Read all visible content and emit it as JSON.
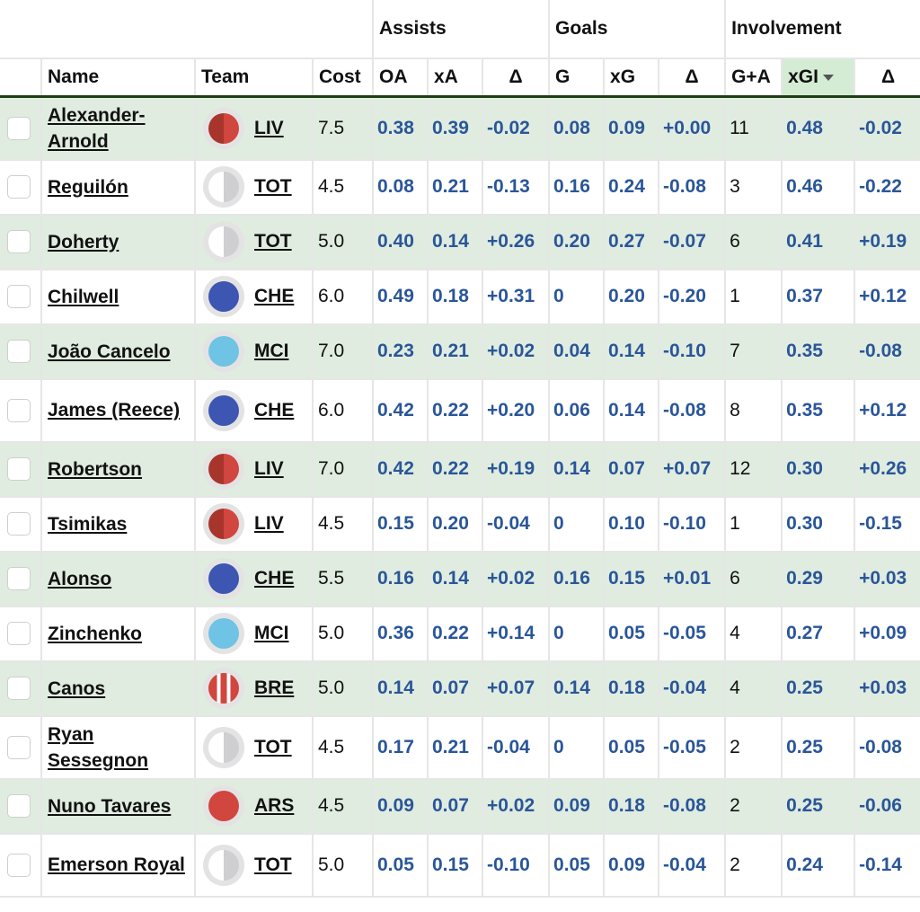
{
  "groups": {
    "assists": "Assists",
    "goals": "Goals",
    "involvement": "Involvement"
  },
  "columns": {
    "name": "Name",
    "team": "Team",
    "cost": "Cost",
    "oa": "OA",
    "xa": "xA",
    "da": "Δ",
    "g": "G",
    "xg": "xG",
    "dg": "Δ",
    "ga": "G+A",
    "xgi": "xGI",
    "dgi": "Δ"
  },
  "sort": {
    "column": "xGI",
    "direction": "descending"
  },
  "team_colors": {
    "LIV": {
      "style": "split",
      "left": "#a8352b",
      "right": "#d1463f"
    },
    "TOT": {
      "style": "split",
      "left": "#ffffff",
      "right": "#cfcfd1"
    },
    "CHE": {
      "style": "solid",
      "color": "#3c56b1"
    },
    "MCI": {
      "style": "solid",
      "color": "#6fc3e5"
    },
    "BRE": {
      "style": "stripes",
      "color": "#d1463f",
      "alt": "#ffffff"
    },
    "ARS": {
      "style": "solid",
      "color": "#d1463f"
    }
  },
  "rows": [
    {
      "name": "Alexander-Arnold",
      "team": "LIV",
      "cost": "7.5",
      "oa": "0.38",
      "xa": "0.39",
      "da": "-0.02",
      "g": "0.08",
      "xg": "0.09",
      "dg": "+0.00",
      "ga": "11",
      "xgi": "0.48",
      "dgi": "-0.02"
    },
    {
      "name": "Reguilón",
      "team": "TOT",
      "cost": "4.5",
      "oa": "0.08",
      "xa": "0.21",
      "da": "-0.13",
      "g": "0.16",
      "xg": "0.24",
      "dg": "-0.08",
      "ga": "3",
      "xgi": "0.46",
      "dgi": "-0.22"
    },
    {
      "name": "Doherty",
      "team": "TOT",
      "cost": "5.0",
      "oa": "0.40",
      "xa": "0.14",
      "da": "+0.26",
      "g": "0.20",
      "xg": "0.27",
      "dg": "-0.07",
      "ga": "6",
      "xgi": "0.41",
      "dgi": "+0.19"
    },
    {
      "name": "Chilwell",
      "team": "CHE",
      "cost": "6.0",
      "oa": "0.49",
      "xa": "0.18",
      "da": "+0.31",
      "g": "0",
      "xg": "0.20",
      "dg": "-0.20",
      "ga": "1",
      "xgi": "0.37",
      "dgi": "+0.12"
    },
    {
      "name": "João Cancelo",
      "team": "MCI",
      "cost": "7.0",
      "oa": "0.23",
      "xa": "0.21",
      "da": "+0.02",
      "g": "0.04",
      "xg": "0.14",
      "dg": "-0.10",
      "ga": "7",
      "xgi": "0.35",
      "dgi": "-0.08"
    },
    {
      "name": "James (Reece)",
      "team": "CHE",
      "cost": "6.0",
      "oa": "0.42",
      "xa": "0.22",
      "da": "+0.20",
      "g": "0.06",
      "xg": "0.14",
      "dg": "-0.08",
      "ga": "8",
      "xgi": "0.35",
      "dgi": "+0.12"
    },
    {
      "name": "Robertson",
      "team": "LIV",
      "cost": "7.0",
      "oa": "0.42",
      "xa": "0.22",
      "da": "+0.19",
      "g": "0.14",
      "xg": "0.07",
      "dg": "+0.07",
      "ga": "12",
      "xgi": "0.30",
      "dgi": "+0.26"
    },
    {
      "name": "Tsimikas",
      "team": "LIV",
      "cost": "4.5",
      "oa": "0.15",
      "xa": "0.20",
      "da": "-0.04",
      "g": "0",
      "xg": "0.10",
      "dg": "-0.10",
      "ga": "1",
      "xgi": "0.30",
      "dgi": "-0.15"
    },
    {
      "name": "Alonso",
      "team": "CHE",
      "cost": "5.5",
      "oa": "0.16",
      "xa": "0.14",
      "da": "+0.02",
      "g": "0.16",
      "xg": "0.15",
      "dg": "+0.01",
      "ga": "6",
      "xgi": "0.29",
      "dgi": "+0.03"
    },
    {
      "name": "Zinchenko",
      "team": "MCI",
      "cost": "5.0",
      "oa": "0.36",
      "xa": "0.22",
      "da": "+0.14",
      "g": "0",
      "xg": "0.05",
      "dg": "-0.05",
      "ga": "4",
      "xgi": "0.27",
      "dgi": "+0.09"
    },
    {
      "name": "Canos",
      "team": "BRE",
      "cost": "5.0",
      "oa": "0.14",
      "xa": "0.07",
      "da": "+0.07",
      "g": "0.14",
      "xg": "0.18",
      "dg": "-0.04",
      "ga": "4",
      "xgi": "0.25",
      "dgi": "+0.03"
    },
    {
      "name": "Ryan Sessegnon",
      "team": "TOT",
      "cost": "4.5",
      "oa": "0.17",
      "xa": "0.21",
      "da": "-0.04",
      "g": "0",
      "xg": "0.05",
      "dg": "-0.05",
      "ga": "2",
      "xgi": "0.25",
      "dgi": "-0.08"
    },
    {
      "name": "Nuno Tavares",
      "team": "ARS",
      "cost": "4.5",
      "oa": "0.09",
      "xa": "0.07",
      "da": "+0.02",
      "g": "0.09",
      "xg": "0.18",
      "dg": "-0.08",
      "ga": "2",
      "xgi": "0.25",
      "dgi": "-0.06"
    },
    {
      "name": "Emerson Royal",
      "team": "TOT",
      "cost": "5.0",
      "oa": "0.05",
      "xa": "0.15",
      "da": "-0.10",
      "g": "0.05",
      "xg": "0.09",
      "dg": "-0.04",
      "ga": "2",
      "xgi": "0.24",
      "dgi": "-0.14"
    }
  ]
}
